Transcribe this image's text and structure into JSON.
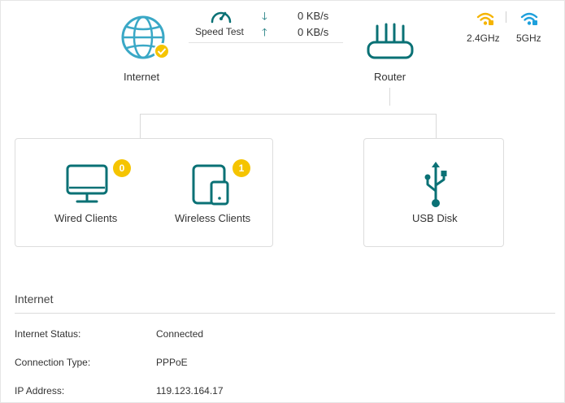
{
  "internet": {
    "label": "Internet"
  },
  "router": {
    "label": "Router"
  },
  "speed_test": {
    "label": "Speed Test",
    "download": "0 KB/s",
    "upload": "0 KB/s"
  },
  "wifi": {
    "band_24": "2.4GHz",
    "band_5": "5GHz",
    "color_24": "#f5b400",
    "color_5": "#1ea0dc"
  },
  "clients": {
    "wired": {
      "label": "Wired Clients",
      "count": "0"
    },
    "wireless": {
      "label": "Wireless Clients",
      "count": "1"
    }
  },
  "usb": {
    "label": "USB Disk"
  },
  "internet_section": {
    "title": "Internet",
    "rows": [
      {
        "label": "Internet Status:",
        "value": "Connected"
      },
      {
        "label": "Connection Type:",
        "value": "PPPoE"
      },
      {
        "label": "IP Address:",
        "value": "119.123.164.17"
      }
    ]
  },
  "colors": {
    "accent": "#0a7175",
    "badge": "#f5c400",
    "globe": "#3aa8c6"
  }
}
